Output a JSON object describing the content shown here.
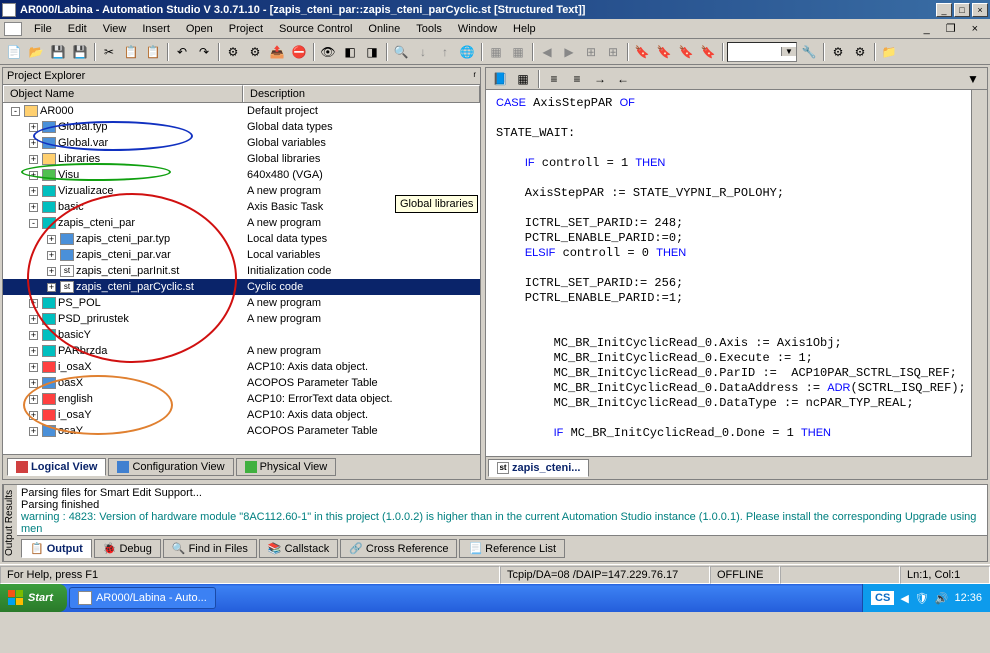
{
  "window": {
    "title": "AR000/Labina - Automation Studio V 3.0.71.10 - [zapis_cteni_par::zapis_cteni_parCyclic.st [Structured Text]]"
  },
  "menu": [
    "File",
    "Edit",
    "View",
    "Insert",
    "Open",
    "Project",
    "Source Control",
    "Online",
    "Tools",
    "Window",
    "Help"
  ],
  "explorer": {
    "title": "Project Explorer",
    "col1": "Object Name",
    "col2": "Description",
    "items": [
      {
        "indent": 0,
        "exp": "-",
        "icon": "folder",
        "name": "AR000",
        "desc": "Default project"
      },
      {
        "indent": 1,
        "exp": "+",
        "icon": "blue",
        "name": "Global.typ",
        "desc": "Global data types"
      },
      {
        "indent": 1,
        "exp": "+",
        "icon": "blue",
        "name": "Global.var",
        "desc": "Global variables"
      },
      {
        "indent": 1,
        "exp": "+",
        "icon": "folder",
        "name": "Libraries",
        "desc": "Global libraries"
      },
      {
        "indent": 1,
        "exp": "+",
        "icon": "green",
        "name": "Visu",
        "desc": "640x480 (VGA)"
      },
      {
        "indent": 1,
        "exp": "+",
        "icon": "cyan",
        "name": "Vizualizace",
        "desc": "A new program"
      },
      {
        "indent": 1,
        "exp": "+",
        "icon": "cyan",
        "name": "basic",
        "desc": "Axis Basic Task"
      },
      {
        "indent": 1,
        "exp": "-",
        "icon": "cyan",
        "name": "zapis_cteni_par",
        "desc": "A new program"
      },
      {
        "indent": 2,
        "exp": "+",
        "icon": "blue",
        "name": "zapis_cteni_par.typ",
        "desc": "Local data types"
      },
      {
        "indent": 2,
        "exp": "+",
        "icon": "blue",
        "name": "zapis_cteni_par.var",
        "desc": "Local variables"
      },
      {
        "indent": 2,
        "exp": "+",
        "icon": "st",
        "name": "zapis_cteni_parInit.st",
        "desc": "Initialization code"
      },
      {
        "indent": 2,
        "exp": "+",
        "icon": "st",
        "name": "zapis_cteni_parCyclic.st",
        "desc": "Cyclic code",
        "sel": true
      },
      {
        "indent": 1,
        "exp": "+",
        "icon": "cyan",
        "name": "PS_POL",
        "desc": "A new program"
      },
      {
        "indent": 1,
        "exp": "+",
        "icon": "cyan",
        "name": "PSD_prirustek",
        "desc": "A new program"
      },
      {
        "indent": 1,
        "exp": "+",
        "icon": "cyan",
        "name": "basicY",
        "desc": ""
      },
      {
        "indent": 1,
        "exp": "+",
        "icon": "cyan",
        "name": "PARbrzda",
        "desc": "A new program"
      },
      {
        "indent": 1,
        "exp": "+",
        "icon": "red",
        "name": "i_osaX",
        "desc": "ACP10: Axis data object."
      },
      {
        "indent": 1,
        "exp": "+",
        "icon": "blue",
        "name": "oasX",
        "desc": "ACOPOS Parameter Table"
      },
      {
        "indent": 1,
        "exp": "+",
        "icon": "red",
        "name": "english",
        "desc": "ACP10: ErrorText data object."
      },
      {
        "indent": 1,
        "exp": "+",
        "icon": "red",
        "name": "i_osaY",
        "desc": "ACP10: Axis data object."
      },
      {
        "indent": 1,
        "exp": "+",
        "icon": "blue",
        "name": "osaY",
        "desc": "ACOPOS Parameter Table"
      }
    ],
    "tabs": [
      {
        "label": "Logical View",
        "active": true
      },
      {
        "label": "Configuration View"
      },
      {
        "label": "Physical View"
      }
    ]
  },
  "tooltip": "Global libraries",
  "editor_tab": "zapis_cteni...",
  "output": {
    "side": "Output Results",
    "line1": "Parsing files for Smart Edit Support...",
    "line2": "Parsing finished",
    "warn": "warning :   4823: Version of hardware module \"8AC112.60-1\" in this project (1.0.0.2) is higher than in the current Automation Studio instance (1.0.0.1). Please install the corresponding Upgrade using men",
    "tabs": [
      {
        "label": "Output",
        "active": true
      },
      {
        "label": "Debug"
      },
      {
        "label": "Find in Files"
      },
      {
        "label": "Callstack"
      },
      {
        "label": "Cross Reference"
      },
      {
        "label": "Reference List"
      }
    ]
  },
  "status": {
    "help": "For Help, press F1",
    "conn": "Tcpip/DA=08 /DAIP=147.229.76.17",
    "mode": "OFFLINE",
    "pos": "Ln:1, Col:1"
  },
  "taskbar": {
    "start": "Start",
    "task": "AR000/Labina - Auto...",
    "lang": "CS",
    "time": "12:36"
  }
}
